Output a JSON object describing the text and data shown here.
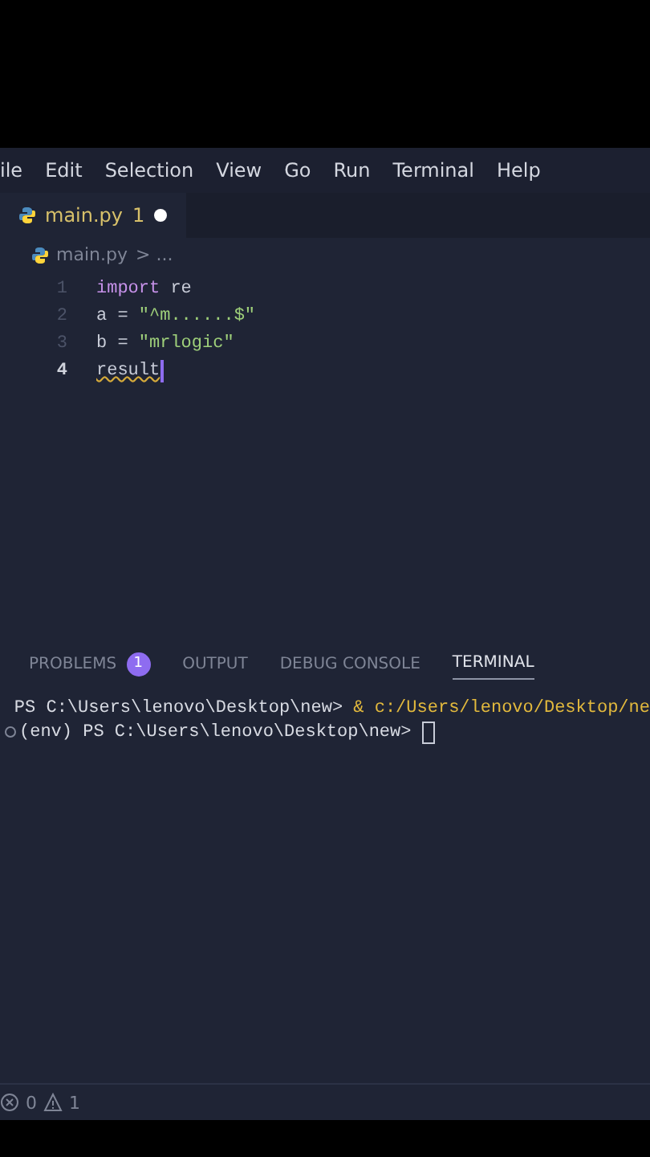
{
  "menu": [
    "ile",
    "Edit",
    "Selection",
    "View",
    "Go",
    "Run",
    "Terminal",
    "Help"
  ],
  "tabs": [
    {
      "label": "main.py",
      "problems": "1",
      "modified": true,
      "selected": true
    }
  ],
  "breadcrumb": {
    "file": "main.py",
    "rest": "> ..."
  },
  "editor": {
    "lines": [
      {
        "number": "1",
        "current": false,
        "tokens": [
          {
            "text": "import",
            "kind": "keyword"
          },
          {
            "text": " re",
            "kind": "plain"
          }
        ]
      },
      {
        "number": "2",
        "current": false,
        "tokens": [
          {
            "text": "a = ",
            "kind": "plain"
          },
          {
            "text": "\"^m......$\"",
            "kind": "string"
          }
        ]
      },
      {
        "number": "3",
        "current": false,
        "tokens": [
          {
            "text": "b = ",
            "kind": "plain"
          },
          {
            "text": "\"mrlogic\"",
            "kind": "string"
          }
        ]
      },
      {
        "number": "4",
        "current": true,
        "tokens": [
          {
            "text": "result",
            "kind": "error"
          }
        ]
      }
    ]
  },
  "panel_tabs": [
    {
      "label": "PROBLEMS",
      "badge": "1",
      "selected": false
    },
    {
      "label": "OUTPUT",
      "selected": false
    },
    {
      "label": "DEBUG CONSOLE",
      "selected": false
    },
    {
      "label": "TERMINAL",
      "selected": true
    }
  ],
  "terminal": [
    {
      "prompt": "PS C:\\Users\\lenovo\\Desktop\\new> ",
      "command": "& c:/Users/lenovo/Desktop/ne",
      "marker": false,
      "cursor": false
    },
    {
      "prompt": "(env) PS C:\\Users\\lenovo\\Desktop\\new> ",
      "marker": true,
      "cursor": true
    }
  ],
  "status_bar": {
    "errors": "0",
    "warnings": "1"
  }
}
